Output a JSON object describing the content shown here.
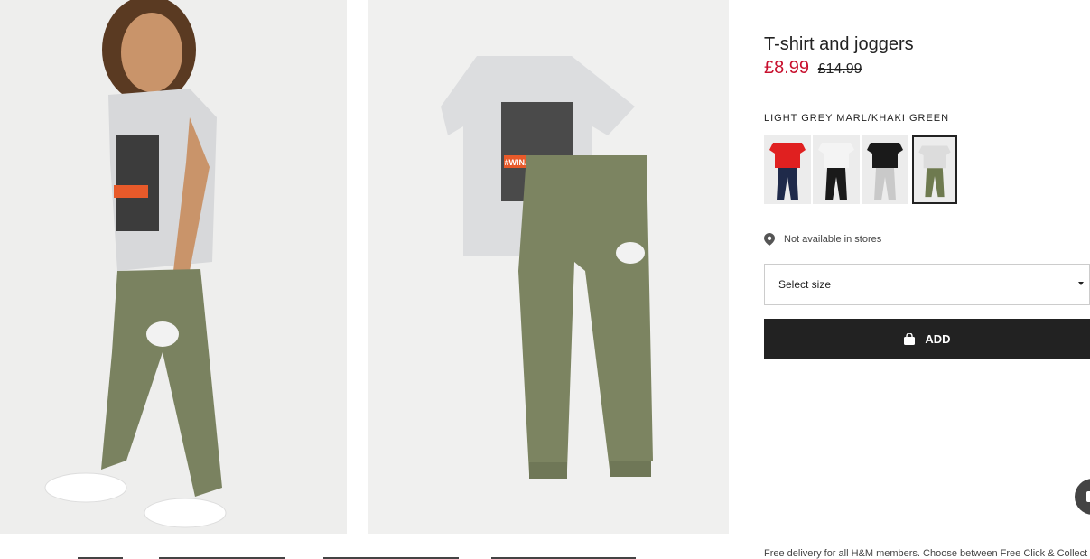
{
  "product": {
    "title": "T-shirt and joggers",
    "price_sale": "£8.99",
    "price_original": "£14.99",
    "color_name": "LIGHT GREY MARL/KHAKI GREEN"
  },
  "swatches": [
    {
      "name": "red-top-navy-joggers",
      "top": "#e02020",
      "bottom": "#1f2a4a"
    },
    {
      "name": "white-top-black-joggers",
      "top": "#f4f4f4",
      "bottom": "#1a1a1a"
    },
    {
      "name": "black-top-grey-joggers",
      "top": "#1a1a1a",
      "bottom": "#c9c9c9"
    },
    {
      "name": "grey-top-khaki-joggers",
      "top": "#dcdcdc",
      "bottom": "#6e7a4f",
      "selected": true
    }
  ],
  "store": {
    "label": "Not available in stores",
    "icon": "map-pin-icon"
  },
  "size_select": {
    "placeholder": "Select size",
    "icon": "caret-down-icon"
  },
  "add_button": {
    "label": "ADD",
    "icon": "shopping-bag-icon"
  },
  "footer": {
    "delivery_text": "Free delivery for all H&M members. Choose between Free Click & Collect"
  },
  "tshirt_print_text": "#WINASAURUS"
}
